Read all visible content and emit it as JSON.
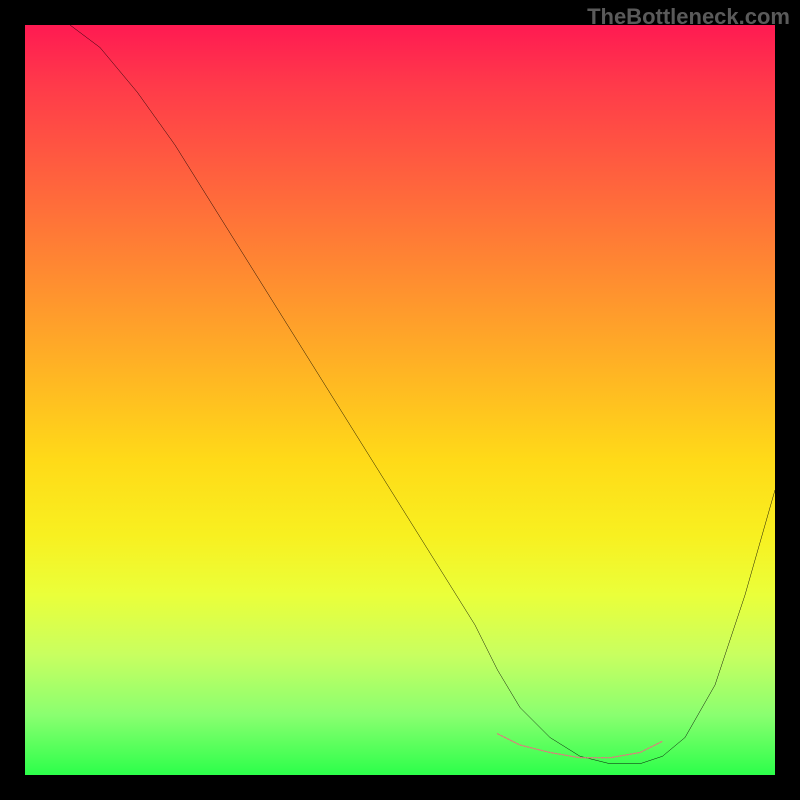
{
  "watermark": "TheBottleneck.com",
  "chart_data": {
    "type": "line",
    "title": "",
    "xlabel": "",
    "ylabel": "",
    "xlim": [
      0,
      100
    ],
    "ylim": [
      0,
      100
    ],
    "background": "rainbow-gradient-red-to-green",
    "series": [
      {
        "name": "main-curve",
        "stroke": "#000000",
        "x": [
          6,
          10,
          15,
          20,
          25,
          30,
          35,
          40,
          45,
          50,
          55,
          60,
          63,
          66,
          70,
          74,
          78,
          82,
          85,
          88,
          92,
          96,
          100
        ],
        "y": [
          100,
          97,
          91,
          84,
          76,
          68,
          60,
          52,
          44,
          36,
          28,
          20,
          14,
          9,
          5,
          2.5,
          1.5,
          1.5,
          2.5,
          5,
          12,
          24,
          38
        ]
      },
      {
        "name": "bottom-overlay",
        "stroke": "#e08080",
        "x": [
          63,
          66,
          70,
          74,
          78,
          82,
          85
        ],
        "y": [
          5.5,
          4,
          3,
          2.3,
          2.3,
          3,
          4.5
        ]
      }
    ]
  }
}
